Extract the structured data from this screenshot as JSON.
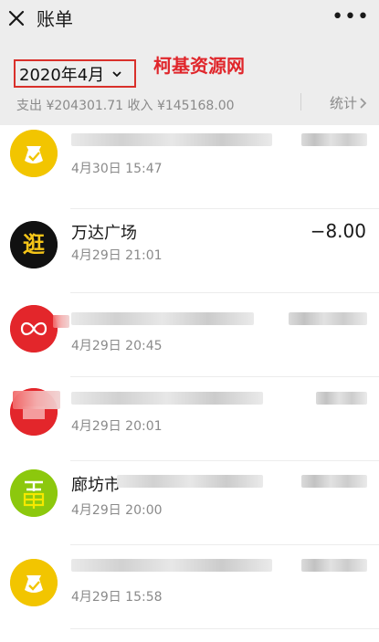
{
  "header": {
    "title": "账单",
    "more_icon": "more-horizontal-icon",
    "close_icon": "close-icon"
  },
  "filters": {
    "month": "2020年4月",
    "watermark": "柯基资源网",
    "summary": "支出 ¥204301.71 收入 ¥145168.00",
    "stats_label": "统计"
  },
  "transactions": [
    {
      "time": "4月30日 15:47",
      "icon": "money-bag-icon",
      "accent": "#f2c500"
    },
    {
      "name": "万达广场",
      "time": "4月29日 21:01",
      "amount": "−8.00",
      "icon": "wanda-logo-icon",
      "accent": "#111111"
    },
    {
      "time": "4月29日 20:45",
      "icon": "infinity-logo-icon",
      "accent": "#e3262b"
    },
    {
      "time": "4月29日 20:01",
      "icon": "red-badge-icon",
      "accent": "#e3262b"
    },
    {
      "name": "廊坊市",
      "time": "4月29日 20:00",
      "icon": "fruit-logo-icon",
      "accent": "#8cc80d"
    },
    {
      "time": "4月29日 15:58",
      "icon": "money-bag-icon",
      "accent": "#f2c500"
    }
  ]
}
